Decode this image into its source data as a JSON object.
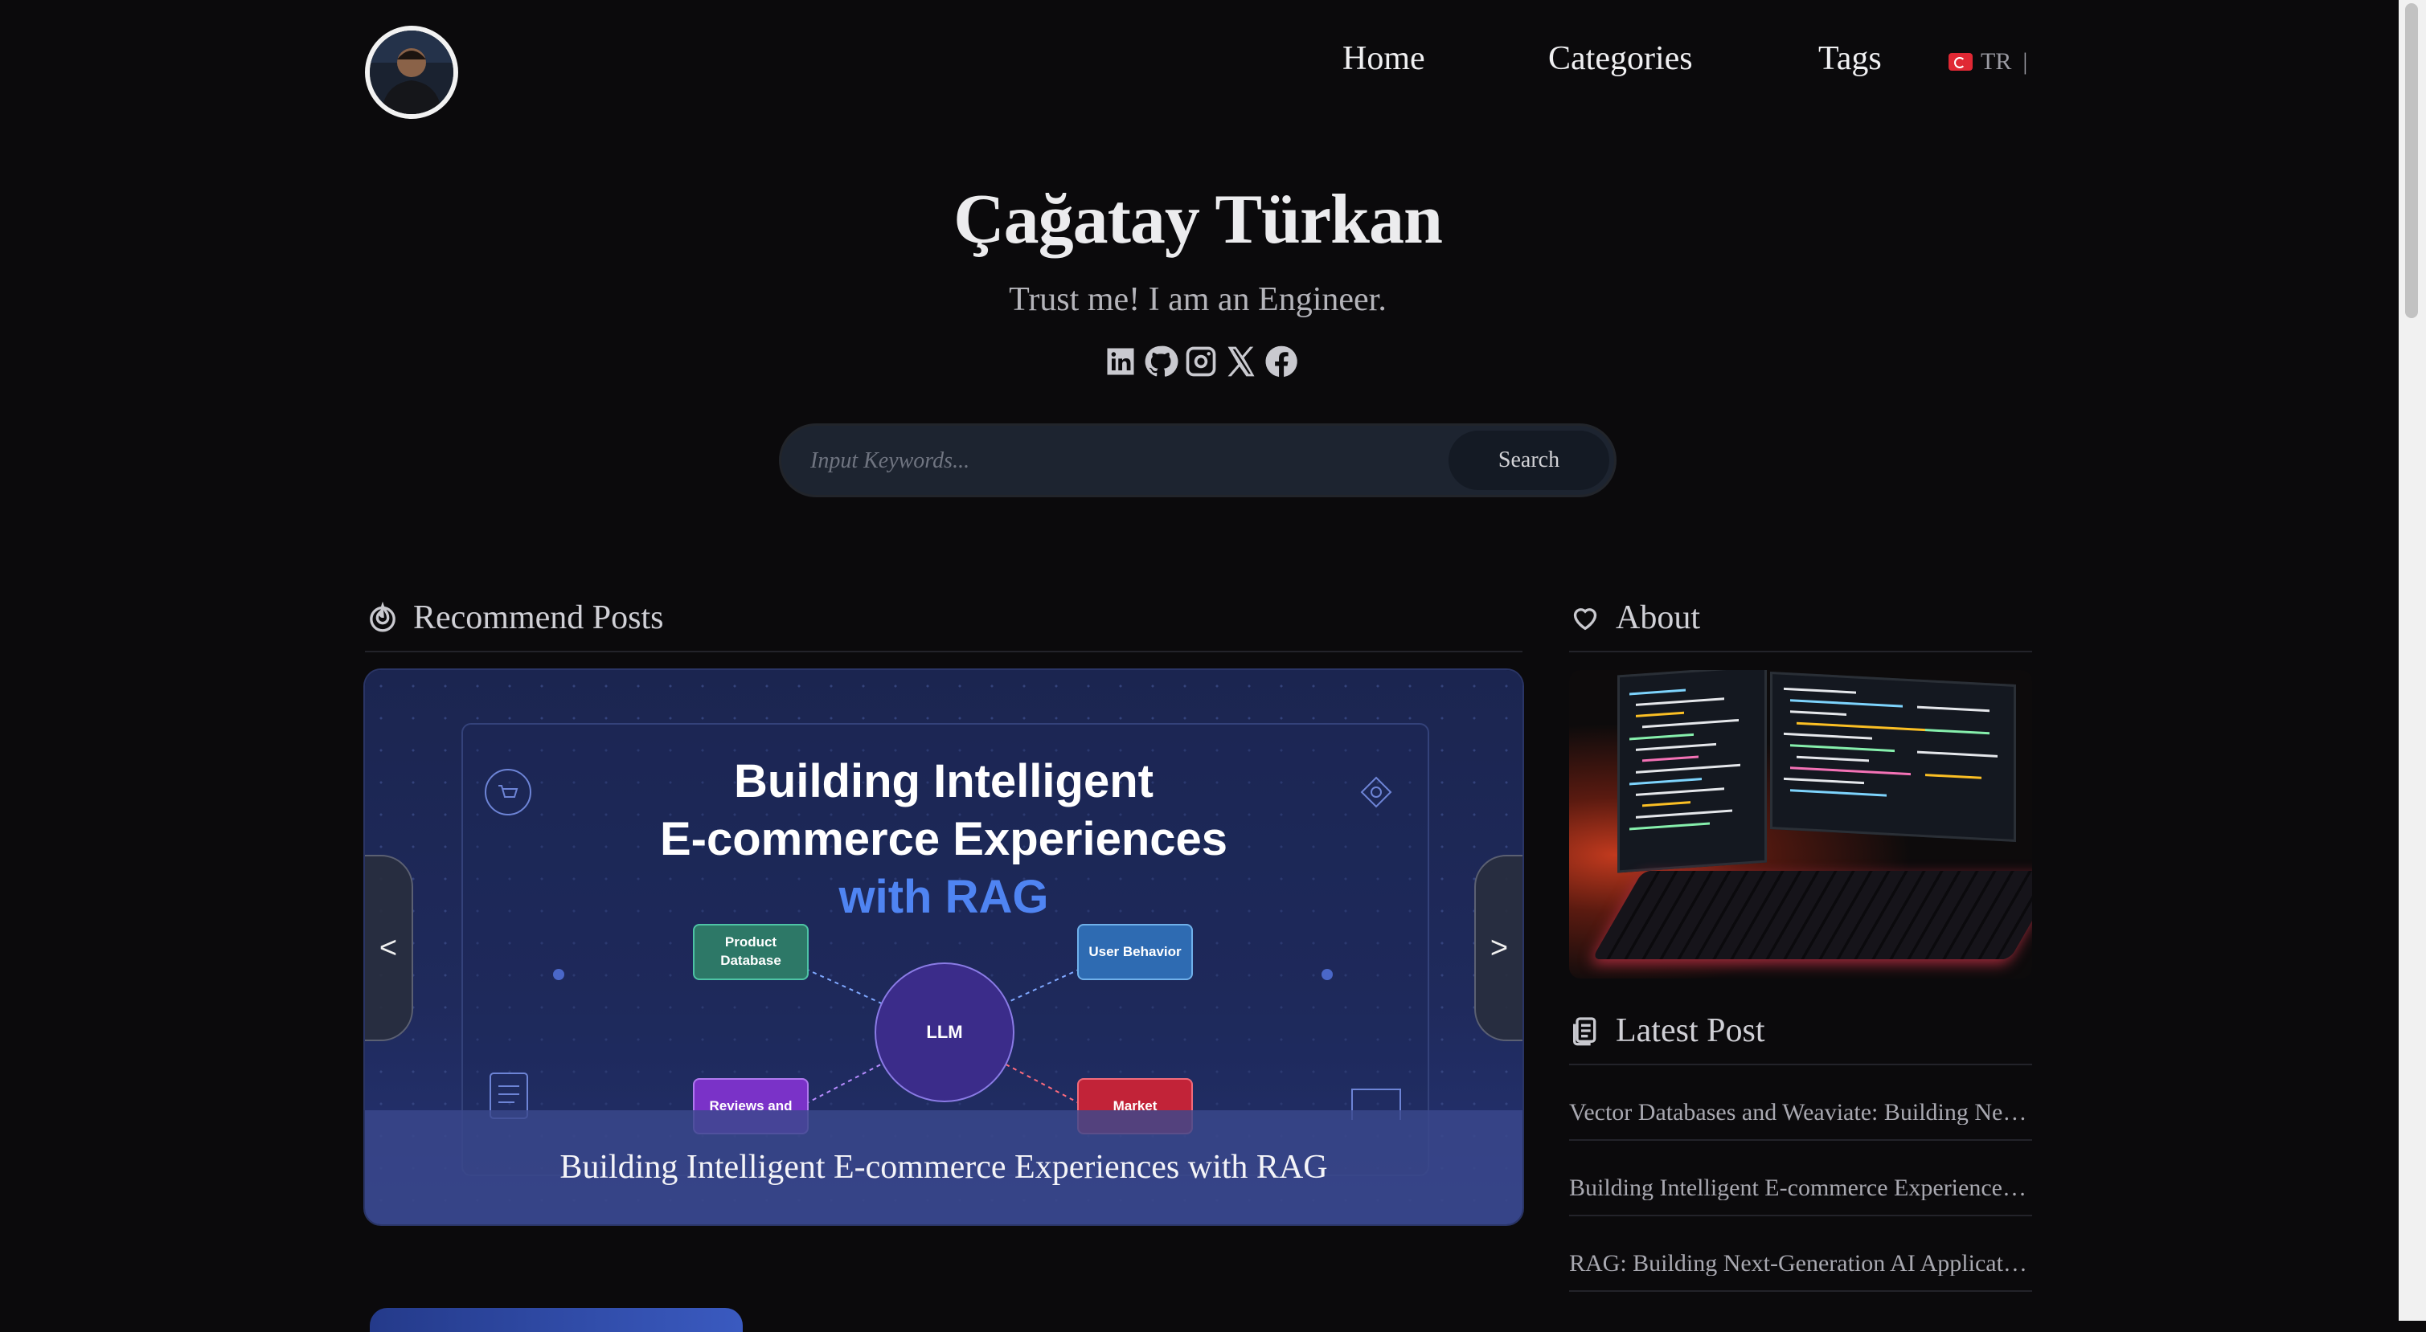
{
  "header": {
    "nav": [
      {
        "label": "Home"
      },
      {
        "label": "Categories"
      },
      {
        "label": "Tags"
      }
    ],
    "lang": "TR",
    "lang_sep": "|"
  },
  "hero": {
    "title": "Çağatay Türkan",
    "subtitle": "Trust me! I am an Engineer.",
    "social_icons": [
      "linkedin-icon",
      "github-icon",
      "instagram-icon",
      "x-icon",
      "facebook-icon"
    ]
  },
  "search": {
    "placeholder": "Input Keywords...",
    "button": "Search"
  },
  "recommend": {
    "heading": "Recommend Posts",
    "slide": {
      "title_line1": "Building Intelligent",
      "title_line2": "E-commerce Experiences",
      "title_line3": "with RAG",
      "nodes": {
        "product": "Product Database",
        "user": "User Behavior",
        "llm": "LLM",
        "reviews": "Reviews and",
        "market": "Market"
      },
      "caption": "Building Intelligent E-commerce Experiences with RAG",
      "prev": "<",
      "next": ">"
    }
  },
  "about": {
    "heading": "About"
  },
  "latest": {
    "heading": "Latest Post",
    "items": [
      "Vector Databases and Weaviate: Building Next-Generation…",
      "Building Intelligent E-commerce Experiences with RAG",
      "RAG: Building Next-Generation AI Applications"
    ]
  },
  "colors": {
    "background": "#0b0a0c",
    "accent_blue": "#4f84f2",
    "search_bg": "#1d2430"
  }
}
